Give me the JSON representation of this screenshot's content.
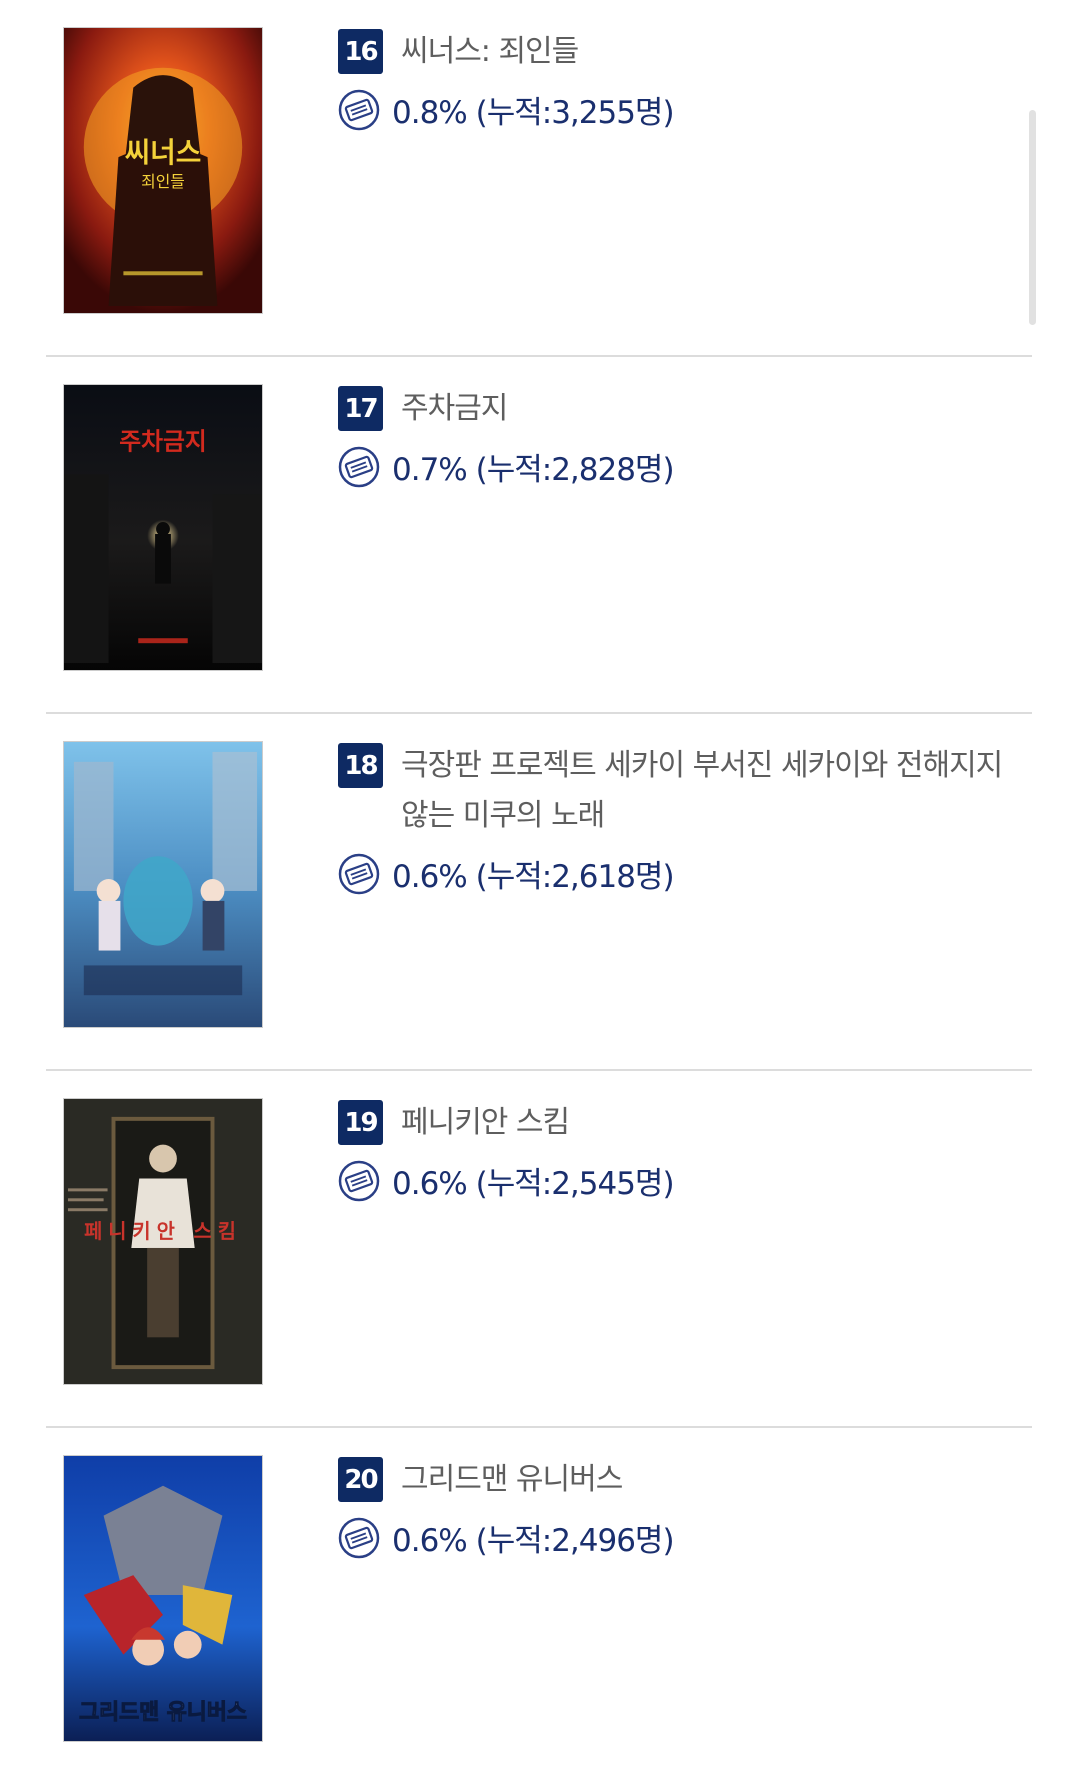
{
  "movies": [
    {
      "rank": "16",
      "title": "씨너스: 죄인들",
      "stat": "0.8% (누적:3,255명)",
      "poster_text": "씨너스\n죄인들"
    },
    {
      "rank": "17",
      "title": "주차금지",
      "stat": "0.7% (누적:2,828명)",
      "poster_text": "주차금지"
    },
    {
      "rank": "18",
      "title": "극장판 프로젝트 세카이 부서진 세카이와 전해지지 않는 미쿠의 노래",
      "stat": "0.6% (누적:2,618명)",
      "poster_text": ""
    },
    {
      "rank": "19",
      "title": "페니키안 스킴",
      "stat": "0.6% (누적:2,545명)",
      "poster_text": "페니키안 스킴"
    },
    {
      "rank": "20",
      "title": "그리드맨 유니버스",
      "stat": "0.6% (누적:2,496명)",
      "poster_text": "그리드맨 유니버스"
    }
  ],
  "colors": {
    "rank_badge": "#0e2a63",
    "stat_text": "#1a2f6e",
    "title_text": "#5e5e5e",
    "divider": "#dcdcdc"
  },
  "icons": {
    "ticket": "ticket-icon"
  }
}
